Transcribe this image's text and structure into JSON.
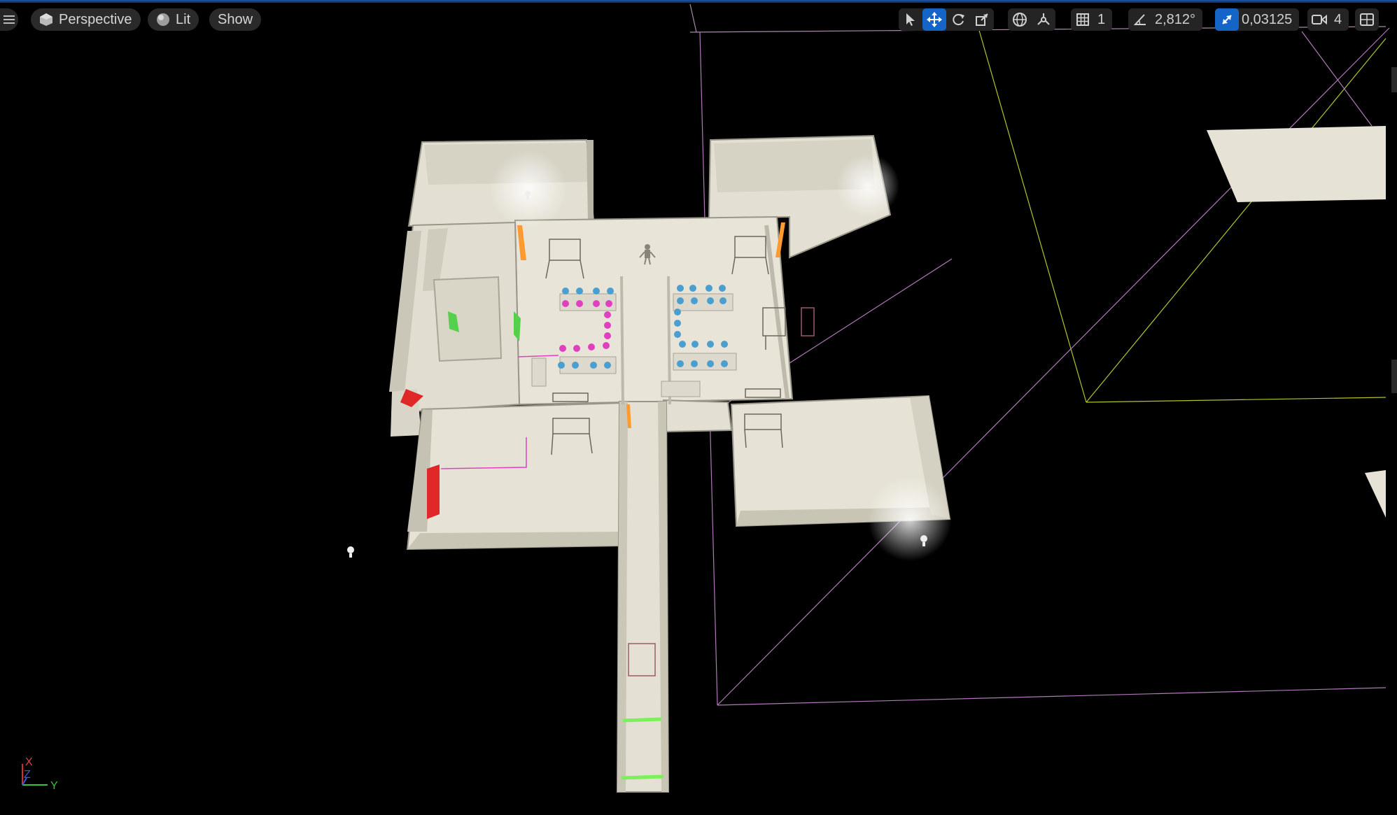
{
  "viewport": {
    "view_mode": "Perspective",
    "lighting_mode": "Lit",
    "show_label": "Show"
  },
  "toolbar": {
    "transform_tools": [
      {
        "name": "select",
        "active": false
      },
      {
        "name": "translate",
        "active": true
      },
      {
        "name": "rotate",
        "active": false
      },
      {
        "name": "scale",
        "active": false
      }
    ],
    "coordinate_space": "world",
    "grid_snap_value": "1",
    "rotation_snap_value": "2,812°",
    "scale_snap_value": "0,03125",
    "camera_speed_value": "4"
  },
  "icons": {
    "menu": "hamburger-menu-icon",
    "perspective": "cube-icon",
    "lit": "sphere-icon",
    "select": "cursor-arrow-icon",
    "translate": "move-arrows-icon",
    "rotate": "rotate-icon",
    "scale": "scale-icon",
    "world": "globe-icon",
    "surface_snap": "surface-snap-icon",
    "grid": "grid-icon",
    "angle": "angle-icon",
    "scale_snap": "scale-arrow-icon",
    "camera": "camera-icon",
    "layout": "viewport-layout-icon"
  },
  "axis_indicator": {
    "x_label": "X",
    "y_label": "Y",
    "z_label": "Z"
  },
  "colors": {
    "accent": "#1565c8",
    "floor": "#e6e3d6",
    "wall": "#c9c5b5",
    "chair_blue": "#4a9fd0",
    "chair_pink": "#e040c0",
    "door_green": "#55d04a",
    "door_red": "#e02828",
    "door_orange": "#ff9a30",
    "bounds_yellow": "#b7c22a",
    "bounds_purple": "#b07ab8"
  }
}
